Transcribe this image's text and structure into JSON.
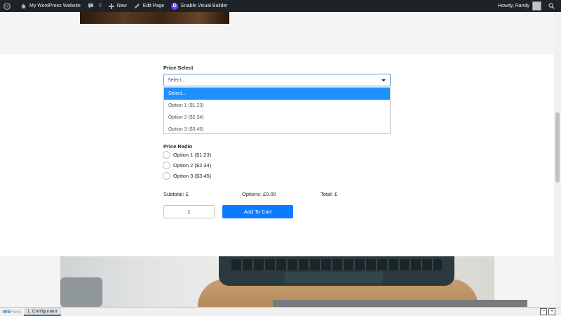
{
  "adminbar": {
    "site_name": "My WordPress Website",
    "comments_count": "0",
    "new_label": "New",
    "edit_label": "Edit Page",
    "builder_label": "Enable Visual Builder",
    "builder_logo": "D",
    "greeting": "Howdy, Randy"
  },
  "form": {
    "select_label": "Price Select",
    "select_value": "Select...",
    "select_options": [
      "Select...",
      "Option 1 ($1.23)",
      "Option 2 ($2.34)",
      "Option 3 ($3.45)"
    ],
    "radio_label": "Price Radio",
    "radio_options": [
      "Option 1 ($1.23)",
      "Option 2 ($2.34)",
      "Option 3 ($3.45)"
    ],
    "subtotal": "Subtotal: £",
    "options_total": "Options: £0.00",
    "total": "Total: £",
    "quantity": "1",
    "add_to_cart": "Add To Cart"
  },
  "debugbar": {
    "logo_main": "WS",
    "logo_sub": "Form",
    "tab": "1. Configurator"
  },
  "colors": {
    "adminbar_bg": "#1d2327",
    "accent": "#0a7cff",
    "selected_option": "#1e90ff",
    "divi_purple": "#7c3bed"
  }
}
